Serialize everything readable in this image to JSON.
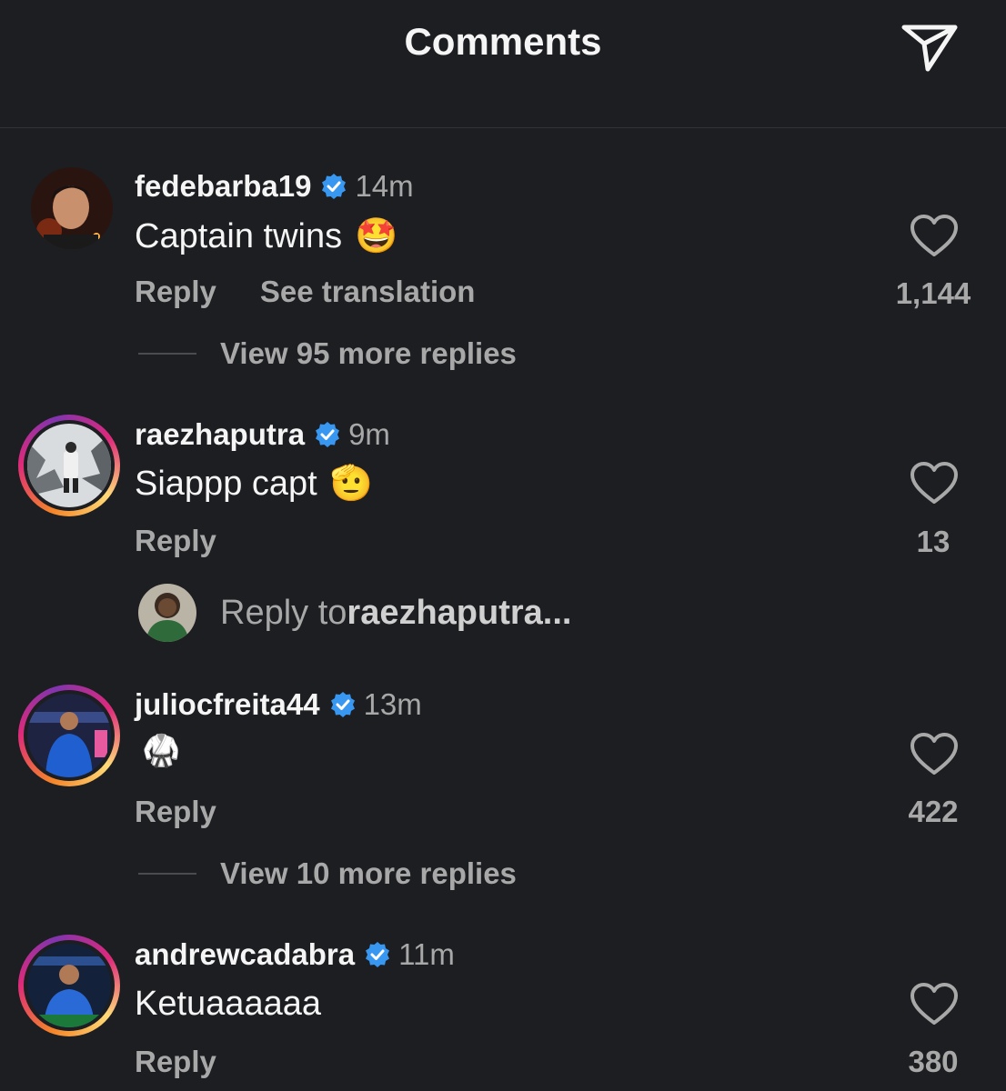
{
  "header": {
    "title": "Comments",
    "share_icon": "send-icon"
  },
  "colors": {
    "background": "#1c1e21",
    "verified": "#3897f0",
    "muted": "#a8a8a8"
  },
  "comments": [
    {
      "username": "fedebarba19",
      "verified": true,
      "time": "14m",
      "text": "Captain twins",
      "emoji": "🤩",
      "reply_label": "Reply",
      "translation_label": "See translation",
      "likes": "1,144",
      "view_replies": "View 95 more replies",
      "story_ring": false
    },
    {
      "username": "raezhaputra",
      "verified": true,
      "time": "9m",
      "text": "Siappp capt",
      "emoji": "🫡",
      "reply_label": "Reply",
      "likes": "13",
      "story_ring": true
    },
    {
      "username": "juliocfreita44",
      "verified": true,
      "time": "13m",
      "text": "",
      "emoji": "🥋",
      "reply_label": "Reply",
      "likes": "422",
      "view_replies": "View 10 more replies",
      "story_ring": true
    },
    {
      "username": "andrewcadabra",
      "verified": true,
      "time": "11m",
      "text": "Ketuaaaaaa",
      "emoji": "",
      "reply_label": "Reply",
      "likes": "380",
      "story_ring": true
    }
  ],
  "reply_prompt": {
    "prefix": "Reply to ",
    "target": "raezhaputra..."
  }
}
